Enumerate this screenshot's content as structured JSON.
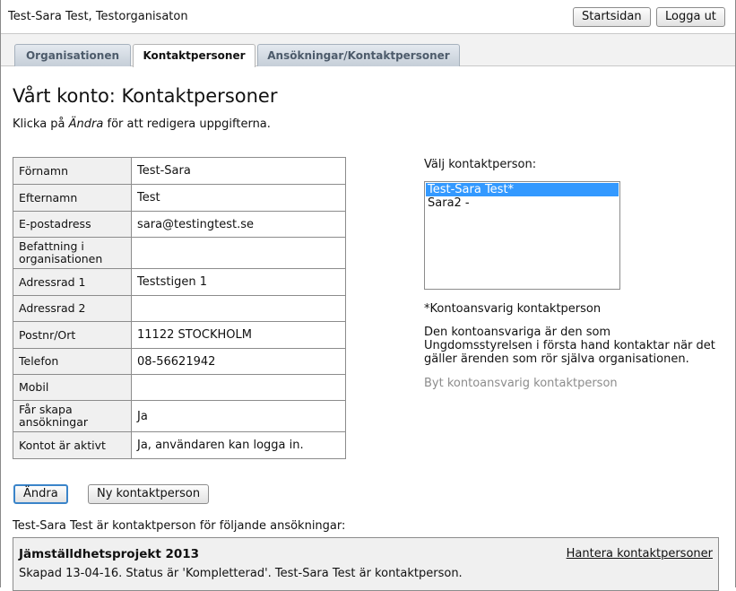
{
  "header": {
    "user_org": "Test-Sara Test, Testorganisaton",
    "home_button": "Startsidan",
    "logout_button": "Logga ut"
  },
  "tabs": [
    {
      "label": "Organisationen",
      "active": false
    },
    {
      "label": "Kontaktpersoner",
      "active": true
    },
    {
      "label": "Ansökningar/Kontaktpersoner",
      "active": false
    }
  ],
  "page": {
    "title": "Vårt konto: Kontaktpersoner",
    "intro_before": "Klicka på ",
    "intro_em": "Ändra",
    "intro_after": " för att redigera uppgifterna."
  },
  "details": [
    {
      "label": "Förnamn",
      "value": "Test-Sara"
    },
    {
      "label": "Efternamn",
      "value": "Test"
    },
    {
      "label": "E-postadress",
      "value": "sara@testingtest.se"
    },
    {
      "label": "Befattning i organisationen",
      "value": ""
    },
    {
      "label": "Adressrad 1",
      "value": "Teststigen 1"
    },
    {
      "label": "Adressrad 2",
      "value": ""
    },
    {
      "label": "Postnr/Ort",
      "value": "11122 STOCKHOLM"
    },
    {
      "label": "Telefon",
      "value": "08-56621942"
    },
    {
      "label": "Mobil",
      "value": ""
    },
    {
      "label": "Får skapa ansökningar",
      "value": "Ja"
    },
    {
      "label": "Kontot är aktivt",
      "value": "Ja, användaren kan logga in."
    }
  ],
  "contact_select": {
    "label": "Välj kontaktperson:",
    "options": [
      "Test-Sara Test*",
      "Sara2 -"
    ],
    "selected_index": 0
  },
  "account_note": "*Kontoansvarig kontaktperson",
  "account_desc": "Den kontoansvariga är den som Ungdomsstyrelsen i första hand kontaktar när det gäller ärenden som rör själva organisationen.",
  "switch_link": "Byt kontoansvarig kontaktperson",
  "actions": {
    "edit_button": "Ändra",
    "new_contact_button": "Ny kontaktperson"
  },
  "applications": {
    "heading": "Test-Sara Test är kontaktperson för följande ansökningar:",
    "items": [
      {
        "title": "Jämställdhetsprojekt 2013",
        "manage_link": "Hantera kontaktpersoner",
        "status": "Skapad 13-04-16. Status är 'Kompletterad'. Test-Sara Test är kontaktperson."
      }
    ]
  }
}
